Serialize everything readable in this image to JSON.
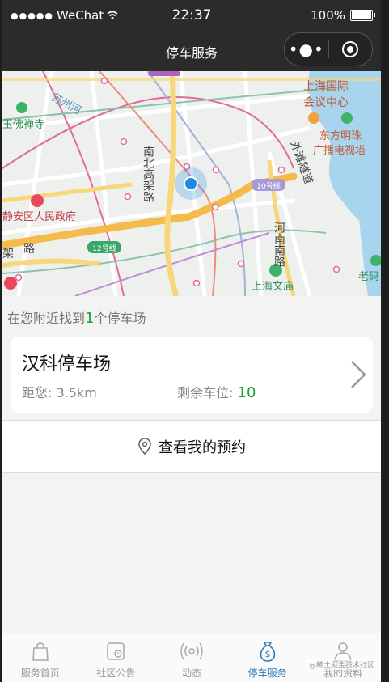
{
  "status_bar": {
    "carrier": "WeChat",
    "time": "22:37",
    "battery": "100%"
  },
  "nav": {
    "title": "停车服务",
    "more_icon": "more-icon",
    "close_icon": "target-icon"
  },
  "map": {
    "labels": {
      "conference": "上海国际",
      "conference2": "会议中心",
      "tv_tower": "东方明珠",
      "tv_tower2": "广播电视塔",
      "temple": "玉佛禅寺",
      "gov": "静安区人民政府",
      "creek": "苏州河",
      "elevated": "南北高架路",
      "tunnel": "外滩隧道",
      "henan": "河南南路",
      "line10": "10号线",
      "line12": "12号线",
      "library": "上海文庙",
      "laoma": "老码",
      "jia": "架",
      "lu": "路"
    },
    "colors": {
      "water": "#a8d4ee",
      "road_major": "#f7d77a",
      "road_elevated": "#f5bb4a",
      "location": "#1e88e5"
    }
  },
  "summary": {
    "prefix": "在您附近找到",
    "count": "1",
    "suffix": "个停车场"
  },
  "parking": {
    "name": "汉科停车场",
    "distance_label": "距您: 3.5km",
    "spots_label": "剩余车位:",
    "spots_value": "10"
  },
  "reservation": {
    "label": "查看我的预约",
    "icon": "location-pin-icon"
  },
  "tabs": [
    {
      "label": "服务首页",
      "icon": "bag-icon"
    },
    {
      "label": "社区公告",
      "icon": "notice-icon"
    },
    {
      "label": "动态",
      "icon": "broadcast-icon"
    },
    {
      "label": "停车服务",
      "icon": "money-bag-icon",
      "active": true
    },
    {
      "label": "我的资料",
      "icon": "person-icon"
    }
  ],
  "watermark": "@稀土掘金技术社区"
}
